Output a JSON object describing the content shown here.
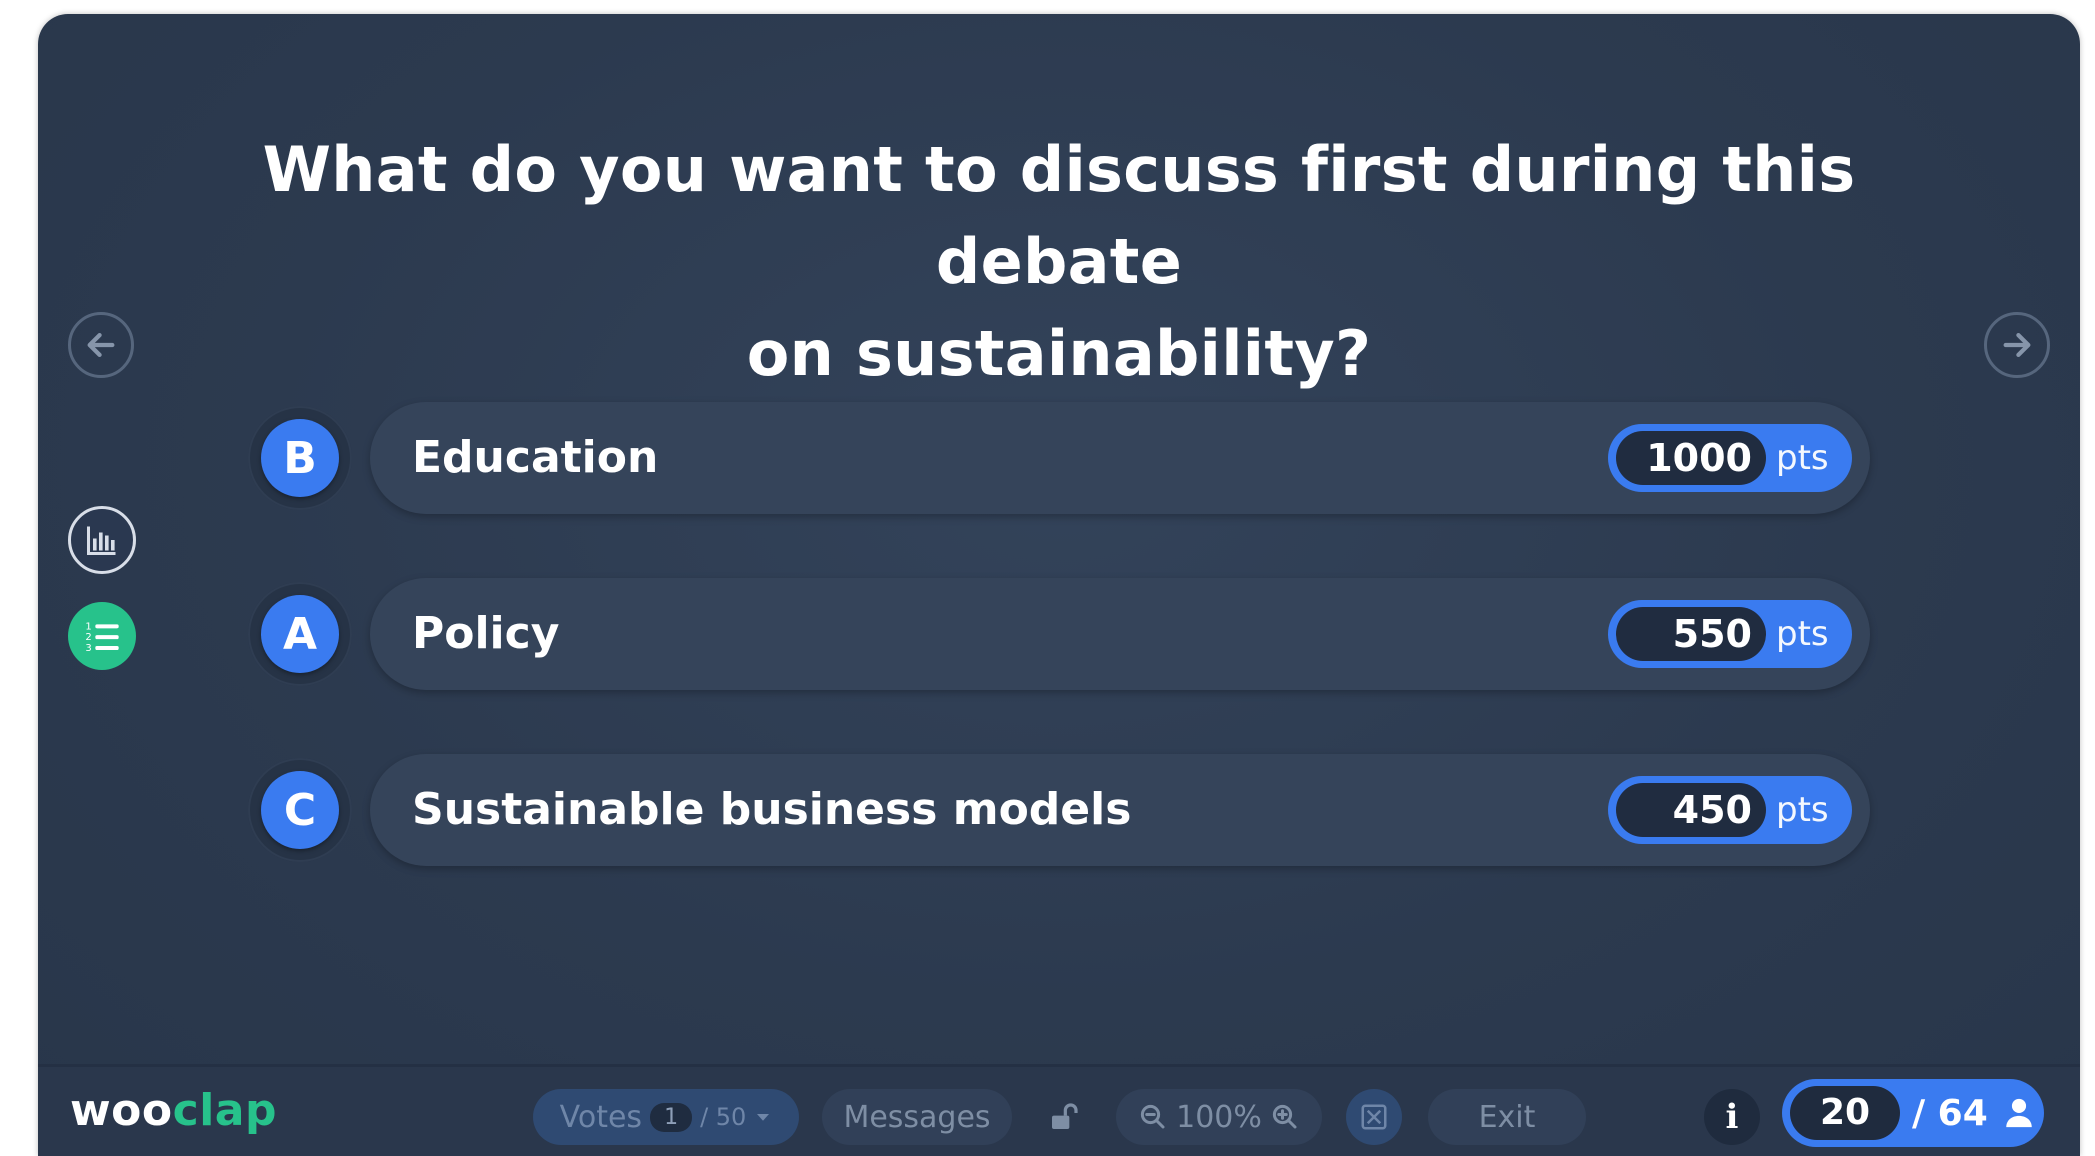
{
  "question": {
    "line1": "What do you want to discuss first during this debate",
    "line2": "on sustainability?"
  },
  "answers": [
    {
      "letter": "B",
      "label": "Education",
      "points": "1000",
      "unit": "pts"
    },
    {
      "letter": "A",
      "label": "Policy",
      "points": "550",
      "unit": "pts"
    },
    {
      "letter": "C",
      "label": "Sustainable business models",
      "points": "450",
      "unit": "pts"
    }
  ],
  "toolbar": {
    "logo_part1": "woo",
    "logo_part2": "clap",
    "votes_label": "Votes",
    "votes_current": "1",
    "votes_total": "/ 50",
    "messages_label": "Messages",
    "zoom_level": "100%",
    "exit_label": "Exit",
    "info_label": "i",
    "participants_current": "20",
    "participants_total": "/ 64"
  },
  "colors": {
    "accent": "#3a7bf0",
    "brand_green": "#27c28b",
    "background": "#2c3a4f"
  },
  "icons": {
    "prev": "arrow-left-icon",
    "next": "arrow-right-icon",
    "chart": "bar-chart-icon",
    "ranking": "numbered-list-icon",
    "lock": "unlock-icon",
    "zoom_out": "zoom-out-icon",
    "zoom_in": "zoom-in-icon",
    "fullscreen": "fullscreen-icon",
    "user": "user-icon"
  }
}
